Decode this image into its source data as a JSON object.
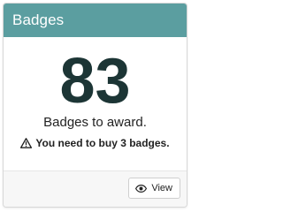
{
  "card": {
    "title": "Badges",
    "count": "83",
    "subtitle": "Badges to award.",
    "warning_icon": "warning-triangle-icon",
    "warning_text": "You need to buy 3 badges.",
    "view_icon": "eye-icon",
    "view_label": "View"
  },
  "colors": {
    "header_background": "#5b9ea0",
    "count_color": "#1c3535"
  }
}
